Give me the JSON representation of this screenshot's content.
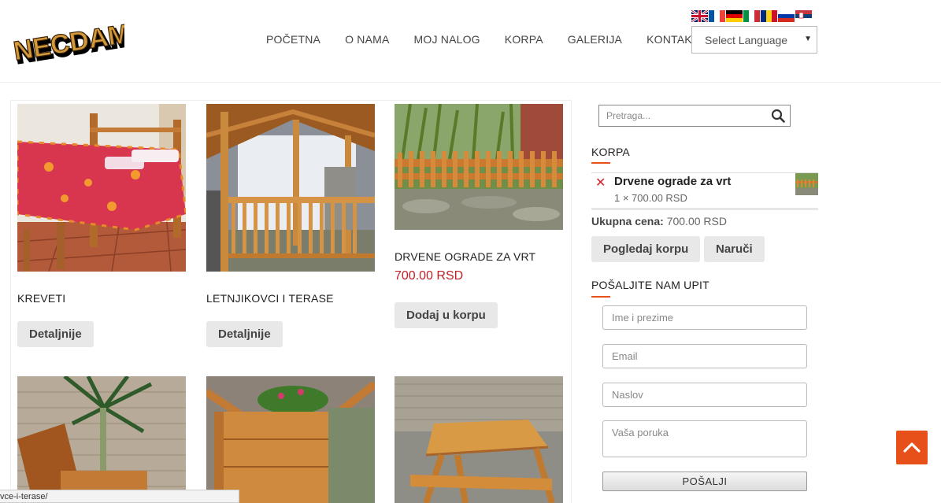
{
  "logo": {
    "text": "NECDAM"
  },
  "nav": {
    "items": [
      "POČETNA",
      "O NAMA",
      "MOJ NALOG",
      "KORPA",
      "GALERIJA",
      "KONTAKT"
    ]
  },
  "language": {
    "flags": [
      "gb-flag-icon",
      "fr-flag-icon",
      "de-flag-icon",
      "it-flag-icon",
      "ro-flag-icon",
      "ru-flag-icon",
      "rs-flag-icon"
    ],
    "select_label": "Select Language"
  },
  "products": [
    {
      "title": "KREVETI",
      "price": "",
      "button": "Detaljnije"
    },
    {
      "title": "LETNJIKOVCI I TERASE",
      "price": "",
      "button": "Detaljnije"
    },
    {
      "title": "DRVENE OGRADE ZA VRT",
      "price": "700.00 RSD",
      "button": "Dodaj u korpu"
    }
  ],
  "search": {
    "placeholder": "Pretraga..."
  },
  "cart": {
    "title": "KORPA",
    "item_name": "Drvene ograde za vrt",
    "item_qty": "1 × 700.00 RSD",
    "total_label": "Ukupna cena:",
    "total_value": "700.00 RSD",
    "view_button": "Pogledaj korpu",
    "order_button": "Naruči"
  },
  "inquiry": {
    "title": "POŠALJITE NAM UPIT",
    "name_placeholder": "Ime i prezime",
    "email_placeholder": "Email",
    "subject_placeholder": "Naslov",
    "message_placeholder": "Vaša poruka",
    "submit_label": "POŠALJI"
  },
  "status_bar": {
    "url": "vce-i-terase/"
  },
  "colors": {
    "accent": "#e8501a",
    "price": "#c0202a",
    "button_bg": "#e8e8e8"
  }
}
